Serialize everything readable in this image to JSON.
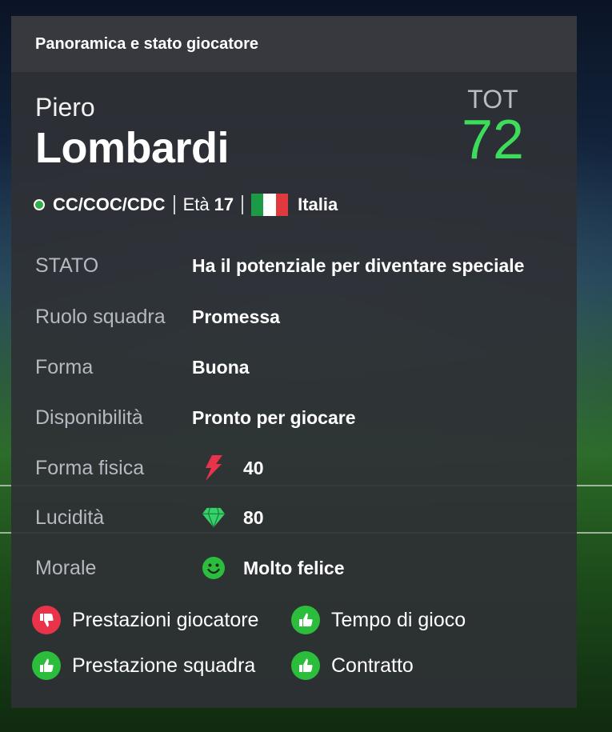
{
  "panel": {
    "title": "Panoramica e stato giocatore"
  },
  "player": {
    "first_name": "Piero",
    "last_name": "Lombardi",
    "overall_label": "TOT",
    "overall_value": "72",
    "positions": "CC/COC/CDC",
    "age_label": "Età",
    "age": "17",
    "nationality": "Italia"
  },
  "stats": [
    {
      "label": "STATO",
      "value": "Ha il potenziale per diventare speciale"
    },
    {
      "label": "Ruolo squadra",
      "value": "Promessa"
    },
    {
      "label": "Forma",
      "value": "Buona"
    },
    {
      "label": "Disponibilità",
      "value": "Pronto per giocare"
    },
    {
      "label": "Forma fisica",
      "value": "40",
      "icon": "lightning-icon"
    },
    {
      "label": "Lucidità",
      "value": "80",
      "icon": "diamond-icon"
    },
    {
      "label": "Morale",
      "value": "Molto felice",
      "icon": "smiley-icon"
    }
  ],
  "factors": [
    {
      "label": "Prestazioni giocatore",
      "sentiment": "negative",
      "icon": "thumbs-down-icon"
    },
    {
      "label": "Tempo di gioco",
      "sentiment": "positive",
      "icon": "thumbs-up-icon"
    },
    {
      "label": "Prestazione squadra",
      "sentiment": "positive",
      "icon": "thumbs-up-icon"
    },
    {
      "label": "Contratto",
      "sentiment": "positive",
      "icon": "thumbs-up-icon"
    }
  ],
  "colors": {
    "accent_green": "#3ddc5a",
    "positive": "#2bbd3b",
    "negative": "#e8334a",
    "fitness": "#e8334a",
    "sharpness": "#35d26a",
    "morale": "#2bbd3b",
    "flag_green": "#1d9a45",
    "flag_white": "#ffffff",
    "flag_red": "#e03a3e"
  }
}
